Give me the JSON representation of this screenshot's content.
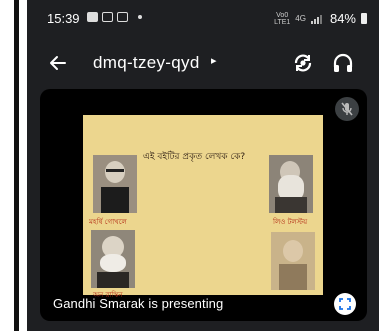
{
  "status_bar": {
    "time": "15:39",
    "network_tag_top": "Vo0",
    "network_tag_bottom": "LTE1",
    "network_type": "4G",
    "battery_percent": "84%"
  },
  "app_bar": {
    "back_icon": "arrow-left-icon",
    "title": "dmq-tzey-qyd",
    "title_chevron": "▸",
    "switch_camera_icon": "switch-camera-icon",
    "audio_icon": "headphones-icon"
  },
  "presentation": {
    "presenter_text": "Gandhi Smarak is presenting",
    "mic_icon": "mic-off-icon",
    "fullscreen_icon": "fullscreen-icon",
    "slide": {
      "question": "এই বইটির প্রকৃত লেখক কে?",
      "captions": [
        "মহর্ষি গোখলে",
        "লিও টলস্টয়",
        "অন রাস্কিন"
      ]
    }
  },
  "colors": {
    "background": "#1e1f22",
    "tile": "#000000",
    "slide_bg": "#ecd68e",
    "caption": "#b32b15"
  }
}
